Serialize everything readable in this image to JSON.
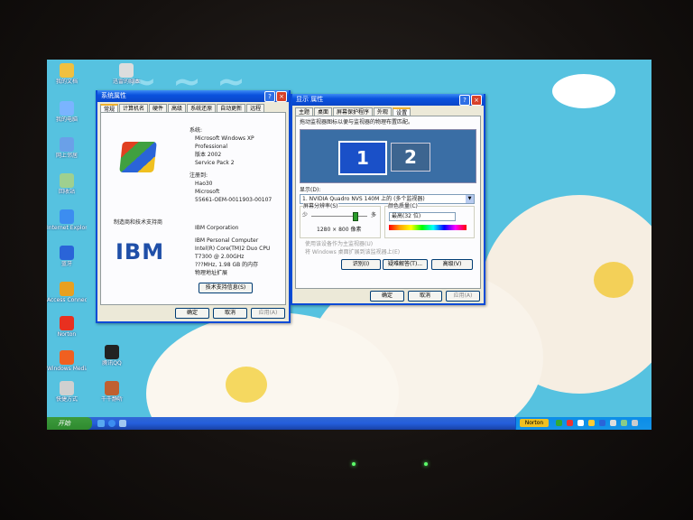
{
  "colors": {
    "desktop": "#56c2e0",
    "xp_blue": "#0a52de",
    "window_bg": "#ece9d8",
    "monitor_bg": "#3a6ea5"
  },
  "desktop": {
    "icons": [
      {
        "label": "我的文档",
        "icon": "folder-icon",
        "color": "#f0c040"
      },
      {
        "label": "迅雷的脚本",
        "icon": "script-icon",
        "color": "#dddddd"
      },
      {
        "label": "我的电脑",
        "icon": "computer-icon",
        "color": "#7ab4ff"
      },
      {
        "label": "网上邻居",
        "icon": "network-icon",
        "color": "#6aa0e8"
      },
      {
        "label": "回收站",
        "icon": "recycle-bin-icon",
        "color": "#9fd08f"
      },
      {
        "label": "Internet Explorer",
        "icon": "ie-icon",
        "color": "#3c8df0"
      },
      {
        "label": "蓝牙",
        "icon": "bluetooth-icon",
        "color": "#2a64d8"
      },
      {
        "label": "Access Connections",
        "icon": "access-icon",
        "color": "#e8a020"
      },
      {
        "label": "Norton",
        "icon": "norton-icon",
        "color": "#e83020"
      },
      {
        "label": "腾讯QQ",
        "icon": "qq-icon",
        "color": "#222222"
      },
      {
        "label": "Windows Media",
        "icon": "media-icon",
        "color": "#f06020"
      },
      {
        "label": "快捷方式",
        "icon": "shortcut-icon",
        "color": "#d0d0d0"
      },
      {
        "label": "千千静听",
        "icon": "music-icon",
        "color": "#c06030"
      }
    ]
  },
  "sys_props": {
    "title": "系统属性",
    "tabs": [
      "常规",
      "计算机名",
      "硬件",
      "高级",
      "系统还原",
      "自动更新",
      "远程"
    ],
    "system_heading": "系统:",
    "system_lines": [
      "Microsoft Windows XP",
      "Professional",
      "版本 2002",
      "Service Pack 2"
    ],
    "registered_heading": "注册到:",
    "registered_lines": [
      "Hao30",
      "Microsoft",
      "55661-OEM-0011903-00107"
    ],
    "manufacturer_label": "制造商和技术支持商",
    "manufacturer_lines": [
      "IBM Corporation",
      "IBM Personal Computer",
      "Intel(R) Core(TM)2 Duo CPU",
      "T7300 @ 2.00GHz",
      "???MHz, 1.98 GB 的内存",
      "物理地址扩展"
    ],
    "logo_text": "IBM",
    "support_button": "技术支持信息(S)",
    "ok": "确定",
    "cancel": "取消",
    "apply": "应用(A)"
  },
  "display_props": {
    "title": "显示 属性",
    "tabs": [
      "主题",
      "桌面",
      "屏幕保护程序",
      "外观",
      "设置"
    ],
    "instruction": "拖动监视器图标以便与监视器的物理布置匹配。",
    "monitor1": "1",
    "monitor2": "2",
    "display_label": "显示(D):",
    "display_value": "1. NVIDIA Quadro NVS 140M 上的 (多个监视器)",
    "resolution_label": "屏幕分辨率(S)",
    "res_less": "少",
    "res_more": "多",
    "resolution_value": "1280 × 800 像素",
    "color_label": "颜色质量(C)",
    "color_value": "最高(32 位)",
    "checkbox1": "使用该设备作为主监视器(U)",
    "checkbox2": "将 Windows 桌面扩展到该监视器上(E)",
    "identify": "识别(I)",
    "troubleshoot": "疑难解答(T)...",
    "advanced": "高级(V)",
    "ok": "确定",
    "cancel": "取消",
    "apply": "应用(A)"
  },
  "taskbar": {
    "start": "开始",
    "norton": "Norton"
  }
}
